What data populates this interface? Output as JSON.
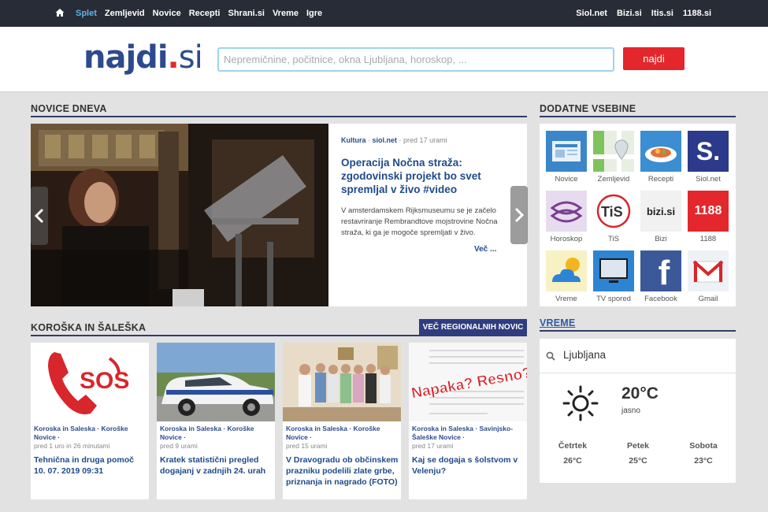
{
  "topbar": {
    "nav": [
      "Splet",
      "Zemljevid",
      "Novice",
      "Recepti",
      "Shrani.si",
      "Vreme",
      "Igre"
    ],
    "links": [
      "Siol.net",
      "Bizi.si",
      "Itis.si",
      "1188.si"
    ],
    "home_icon": "home-icon"
  },
  "header": {
    "logo_main": "najdi",
    "logo_dot": ".",
    "logo_tld": "si",
    "search_placeholder": "Nepremičnine, počitnice, okna Ljubljana, horoskop, ...",
    "search_button": "najdi"
  },
  "news_of_day": {
    "title": "NOVICE DNEVA",
    "category": "Kultura",
    "source": "siol.net",
    "time": "pred 17 urami",
    "headline": "Operacija Nočna straža: zgodovinski projekt bo svet spremljal v živo #video",
    "description": "V amsterdamskem Rijksmuseumu se je začelo restavriranje Rembrandtove mojstrovine Nočna straža, ki ga je mogoče spremljati v živo.",
    "more": "Več ..."
  },
  "regional": {
    "title": "KOROŠKA IN ŠALEŠKA",
    "more_button": "VEČ REGIONALNIH NOVIC",
    "cards": [
      {
        "cats": "Koroska in Saleska · Koroške Novice ·",
        "time": "pred 1 uro in 26 minutami",
        "title": "Tehnična in druga pomoč 10. 07. 2019 09:31",
        "thumb": "sos"
      },
      {
        "cats": "Koroska in Saleska · Koroške Novice ·",
        "time": "pred 9 urami",
        "title": "Kratek statistični pregled dogajanj v zadnjih 24. urah",
        "thumb": "police"
      },
      {
        "cats": "Koroska in Saleska · Koroške Novice ·",
        "time": "pred 15 urami",
        "title": "V Dravogradu ob občinskem prazniku podelili zlate grbe, priznanja in nagrado (FOTO)",
        "thumb": "group"
      },
      {
        "cats": "Koroska in Saleska · Savinjsko-Šaleške Novice ·",
        "time": "pred 17 urami",
        "title": "Kaj se dogaja s šolstvom v Velenju?",
        "thumb": "document",
        "thumb_text": "Napaka? Resno?"
      }
    ]
  },
  "extras": {
    "title": "DODATNE VSEBINE",
    "tiles": [
      {
        "label": "Novice",
        "icon": "news-icon"
      },
      {
        "label": "Zemljevid",
        "icon": "map-icon"
      },
      {
        "label": "Recepti",
        "icon": "recipe-icon"
      },
      {
        "label": "Siol.net",
        "icon": "siol-icon",
        "text": "S."
      },
      {
        "label": "Horoskop",
        "icon": "horoscope-icon"
      },
      {
        "label": "TiS",
        "icon": "tis-icon",
        "text": "TiS"
      },
      {
        "label": "Bizi",
        "icon": "bizi-icon",
        "text": "bizi.si"
      },
      {
        "label": "1188",
        "icon": "1188-icon",
        "text": "1188"
      },
      {
        "label": "Vreme",
        "icon": "weather-icon"
      },
      {
        "label": "TV spored",
        "icon": "tv-icon"
      },
      {
        "label": "Facebook",
        "icon": "facebook-icon",
        "text": "f"
      },
      {
        "label": "Gmail",
        "icon": "gmail-icon"
      }
    ]
  },
  "weather": {
    "title": "VREME",
    "city": "Ljubljana",
    "temp": "20°C",
    "desc": "jasno",
    "days": [
      {
        "name": "Četrtek",
        "temp": "26°C"
      },
      {
        "name": "Petek",
        "temp": "25°C"
      },
      {
        "name": "Sobota",
        "temp": "23°C"
      }
    ]
  },
  "colors": {
    "accent": "#2f3d80",
    "button_red": "#e3272c",
    "link_blue": "#1f4a8a"
  }
}
